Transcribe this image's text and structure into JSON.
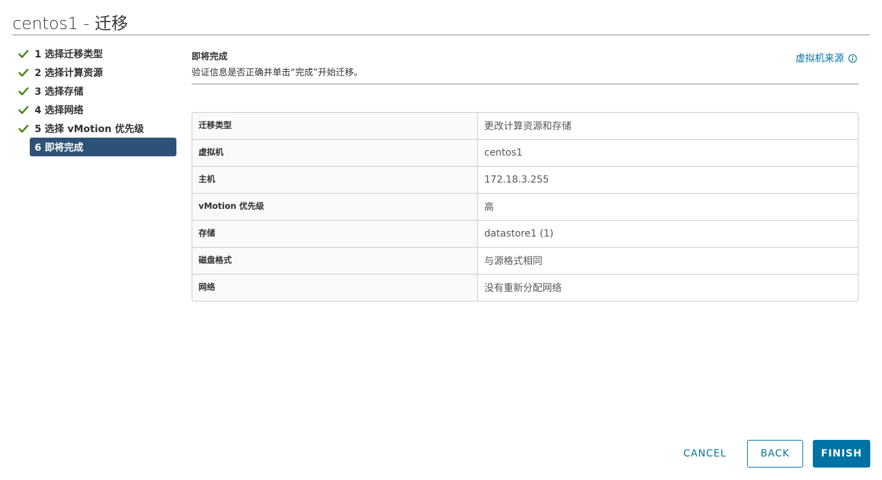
{
  "window": {
    "title": "centos1 - 迁移"
  },
  "steps": [
    {
      "label": "1 选择迁移类型",
      "status": "complete"
    },
    {
      "label": "2 选择计算资源",
      "status": "complete"
    },
    {
      "label": "3 选择存储",
      "status": "complete"
    },
    {
      "label": "4 选择网络",
      "status": "complete"
    },
    {
      "label": "5 选择 vMotion 优先级",
      "status": "complete"
    },
    {
      "label": "6 即将完成",
      "status": "active"
    }
  ],
  "content": {
    "title": "即将完成",
    "description": "验证信息是否正确并单击“完成”开始迁移。",
    "vm_origin_link": "虚拟机来源",
    "vm_origin_icon": "info-icon"
  },
  "summary": [
    {
      "label": "迁移类型",
      "value": "更改计算资源和存储"
    },
    {
      "label": "虚拟机",
      "value": "centos1"
    },
    {
      "label": "主机",
      "value": "172.18.3.255"
    },
    {
      "label": "vMotion 优先级",
      "value": "高"
    },
    {
      "label": "存储",
      "value": "datastore1 (1)"
    },
    {
      "label": "磁盘格式",
      "value": "与源格式相同"
    },
    {
      "label": "网络",
      "value": "没有重新分配网络"
    }
  ],
  "footer": {
    "cancel_label": "CANCEL",
    "back_label": "BACK",
    "finish_label": "FINISH"
  },
  "colors": {
    "accent": "#0072a3",
    "active_step": "#2e5277",
    "check": "#3c8500"
  }
}
